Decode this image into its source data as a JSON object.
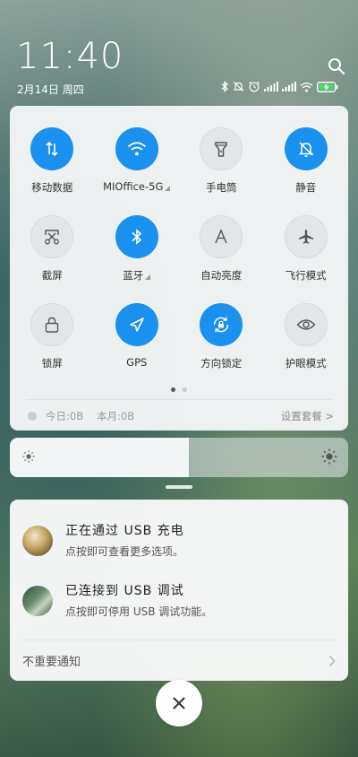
{
  "status_bar": {
    "time": "11:40",
    "date": "2月14日 周四",
    "battery_charging": true,
    "icons": [
      "bluetooth-icon",
      "mute-icon",
      "alarm-icon",
      "signal-icon",
      "signal-icon",
      "wifi-icon",
      "battery-charging-icon"
    ]
  },
  "quick_settings": {
    "tiles": [
      {
        "label": "移动数据",
        "icon": "mobile-data-icon",
        "active": true
      },
      {
        "label": "MIOffice-5G",
        "icon": "wifi-icon",
        "active": true,
        "has_menu": true
      },
      {
        "label": "手电筒",
        "icon": "flashlight-icon",
        "active": false
      },
      {
        "label": "静音",
        "icon": "mute-icon",
        "active": true
      },
      {
        "label": "截屏",
        "icon": "screenshot-icon",
        "active": false
      },
      {
        "label": "蓝牙",
        "icon": "bluetooth-icon",
        "active": true,
        "has_menu": true
      },
      {
        "label": "自动亮度",
        "icon": "auto-brightness-icon",
        "active": false
      },
      {
        "label": "飞行模式",
        "icon": "airplane-icon",
        "active": false
      },
      {
        "label": "锁屏",
        "icon": "lock-icon",
        "active": false
      },
      {
        "label": "GPS",
        "icon": "gps-icon",
        "active": true
      },
      {
        "label": "方向锁定",
        "icon": "rotation-lock-icon",
        "active": true
      },
      {
        "label": "护眼模式",
        "icon": "eye-icon",
        "active": false
      }
    ],
    "page_index": 1,
    "page_count": 2,
    "data_usage": {
      "today": "今日:0B",
      "month": "本月:0B",
      "settings_link": "设置套餐 >"
    }
  },
  "brightness": {
    "level": 0.53
  },
  "notifications": {
    "items": [
      {
        "title": "正在通过 USB 充电",
        "subtitle": "点按即可查看更多选项。"
      },
      {
        "title": "已连接到 USB 调试",
        "subtitle": "点按即可停用 USB 调试功能。"
      }
    ],
    "footer_label": "不重要通知"
  },
  "colors": {
    "accent": "#1a90ef",
    "tile_off": "#e3e6e8",
    "panel_bg": "#f4f6f7"
  }
}
